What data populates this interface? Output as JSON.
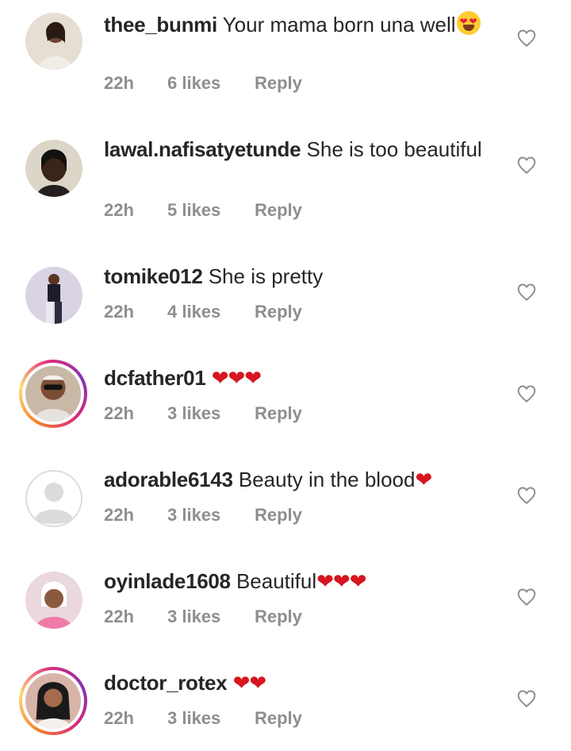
{
  "comments": [
    {
      "username": "thee_bunmi",
      "text": "Your mama born una well",
      "emoji": "heart-eyes",
      "time": "22h",
      "likes": "6 likes",
      "reply": "Reply",
      "story": false
    },
    {
      "username": "lawal.nafisatyetunde",
      "text": "She is too beautiful",
      "time": "22h",
      "likes": "5 likes",
      "reply": "Reply",
      "story": false
    },
    {
      "username": "tomike012",
      "text": "She is pretty",
      "time": "22h",
      "likes": "4 likes",
      "reply": "Reply",
      "story": false
    },
    {
      "username": "dcfather01",
      "text": "",
      "hearts": "❤❤❤",
      "time": "22h",
      "likes": "3 likes",
      "reply": "Reply",
      "story": true
    },
    {
      "username": "adorable6143",
      "text": "Beauty in the blood",
      "hearts": "❤",
      "time": "22h",
      "likes": "3 likes",
      "reply": "Reply",
      "story": false
    },
    {
      "username": "oyinlade1608",
      "text": "Beautiful",
      "hearts": "❤❤❤",
      "time": "22h",
      "likes": "3 likes",
      "reply": "Reply",
      "story": false
    },
    {
      "username": "doctor_rotex",
      "text": "",
      "hearts": "❤❤",
      "time": "22h",
      "likes": "3 likes",
      "reply": "Reply",
      "story": true
    }
  ],
  "colors": {
    "text": "#262626",
    "meta": "#8e8e8e",
    "heart": "#d7151f",
    "like_outline": "#8e8e8e"
  },
  "icons": {
    "like": "heart-outline-icon",
    "emoji": "heart-eyes-emoji"
  }
}
